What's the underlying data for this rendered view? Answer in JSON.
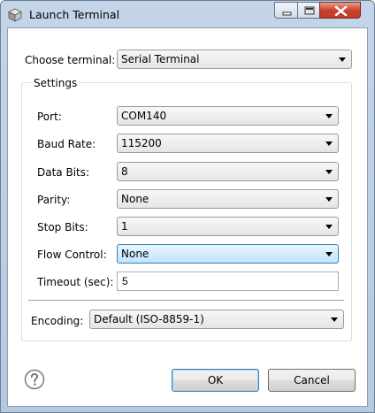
{
  "window": {
    "title": "Launch Terminal",
    "icon": "terminal-cube-icon"
  },
  "form": {
    "choose_terminal_label": "Choose terminal:",
    "choose_terminal_value": "Serial Terminal",
    "settings_group_title": "Settings",
    "port_label": "Port:",
    "port_value": "COM140",
    "baud_rate_label": "Baud Rate:",
    "baud_rate_value": "115200",
    "data_bits_label": "Data Bits:",
    "data_bits_value": "8",
    "parity_label": "Parity:",
    "parity_value": "None",
    "stop_bits_label": "Stop Bits:",
    "stop_bits_value": "1",
    "flow_control_label": "Flow Control:",
    "flow_control_value": "None",
    "timeout_label": "Timeout (sec):",
    "timeout_value": "5",
    "encoding_label": "Encoding:",
    "encoding_value": "Default (ISO-8859-1)"
  },
  "buttons": {
    "ok_label": "OK",
    "cancel_label": "Cancel",
    "help_icon": "help-icon"
  },
  "colors": {
    "title_bar": "#c5d5e8",
    "close_button": "#c8432b",
    "focus_border": "#3c7fb1"
  }
}
